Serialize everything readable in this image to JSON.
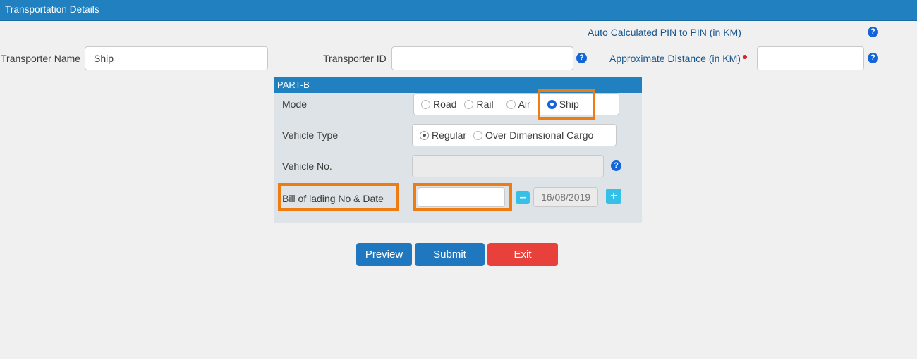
{
  "window": {
    "title": "Transportation Details",
    "title_bar_color": "#2180c0",
    "page_background": "#f0f0f0"
  },
  "top_form": {
    "transporter_name": {
      "label": "Transporter Name",
      "value": "Ship",
      "placeholder": ""
    },
    "transporter_id": {
      "label": "Transporter ID",
      "value": "",
      "placeholder": "",
      "help_icon": "help-circle-icon"
    },
    "auto_calculated_pin": {
      "label": "Auto Calculated PIN to PIN (in KM)",
      "help_icon": "help-circle-icon"
    },
    "approximate_distance": {
      "label": "Approximate Distance (in KM)",
      "required": true,
      "value": "",
      "placeholder": "",
      "help_icon": "help-circle-icon"
    }
  },
  "part_b": {
    "header": "PART-B",
    "panel_background": "#dde3e6",
    "rows": {
      "mode": {
        "label": "Mode",
        "options": [
          "Road",
          "Rail",
          "Air",
          "Ship"
        ],
        "selected": "Ship"
      },
      "vehicle_type": {
        "label": "Vehicle Type",
        "options": [
          "Regular",
          "Over Dimensional Cargo"
        ],
        "selected": "Regular"
      },
      "vehicle_no": {
        "label": "Vehicle No.",
        "value": "",
        "placeholder": "",
        "disabled": true,
        "help_icon": "help-circle-icon"
      },
      "bill_of_lading": {
        "label": "Bill of lading No & Date",
        "number_value": "",
        "number_placeholder": "",
        "date_value": "16/08/2019",
        "remove_button_label": "–",
        "add_button_label": "+"
      }
    }
  },
  "actions": {
    "preview": "Preview",
    "submit": "Submit",
    "exit": "Exit"
  },
  "highlights": {
    "accent_color": "#ef7c10",
    "items": [
      "mode-ship-option",
      "bill-of-lading-label",
      "bill-of-lading-number-input"
    ]
  }
}
